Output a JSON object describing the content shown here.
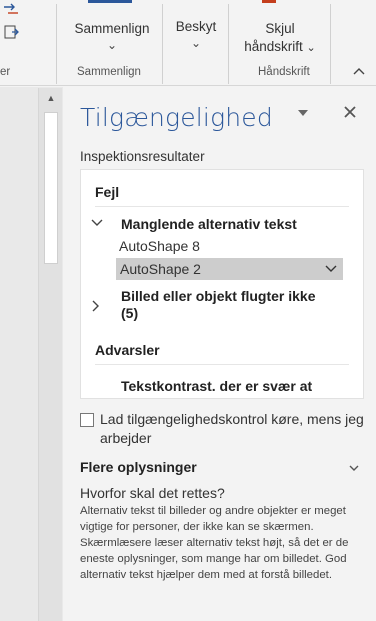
{
  "ribbon": {
    "left_group_label": "er",
    "compare": {
      "label": "Sammenlign",
      "group_label": "Sammenlign"
    },
    "protect": {
      "label": "Beskyt"
    },
    "ink": {
      "label_line1": "Skjul",
      "label_line2": "håndskrift",
      "group_label": "Håndskrift"
    }
  },
  "pane": {
    "title": "Tilgængelighed",
    "subheading": "Inspektionsresultater",
    "results": {
      "errors_heading": "Fejl",
      "issue1": {
        "label": "Manglende alternativ tekst",
        "items": [
          "AutoShape 8",
          "AutoShape 2"
        ]
      },
      "issue2": {
        "label_line1": "Billed eller objekt flugter ikke",
        "label_line2": "(5)"
      },
      "warnings_heading": "Advarsler",
      "warning1": "Tekstkontrast. der er svær at"
    },
    "checkbox_label": "Lad tilgængelighedskontrol køre, mens jeg arbejder",
    "more_info": {
      "heading": "Flere oplysninger",
      "question": "Hvorfor skal det rettes?",
      "explanation": "Alternativ tekst til billeder og andre objekter er meget vigtige for personer, der ikke kan se skærmen. Skærmlæsere læser alternativ tekst højt, så det er de eneste oplysninger, som mange har om billedet. God alternativ tekst hjælper dem med at forstå billedet."
    }
  },
  "colors": {
    "accent": "#2b579a",
    "selected_bg": "#cdcdcd"
  }
}
